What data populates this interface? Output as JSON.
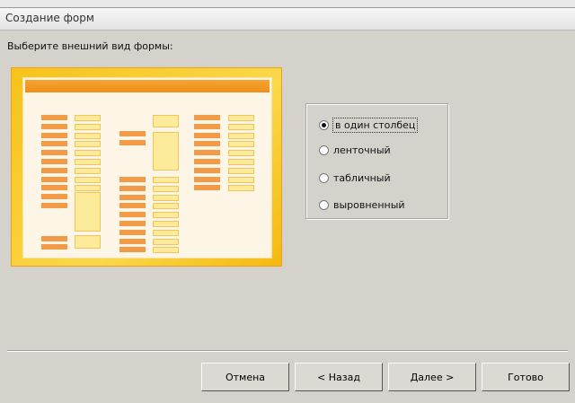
{
  "window": {
    "title": "Создание форм"
  },
  "prompt": "Выберите внешний вид формы:",
  "layout_options": [
    {
      "label": "в один столбец",
      "selected": true
    },
    {
      "label": "ленточный",
      "selected": false
    },
    {
      "label": "табличный",
      "selected": false
    },
    {
      "label": "выровненный",
      "selected": false
    }
  ],
  "buttons": {
    "cancel": "Отмена",
    "back": "< Назад",
    "next": "Далее >",
    "finish": "Готово"
  },
  "colors": {
    "preview_frame": "#f7c21a",
    "label_bar": "#f19a48",
    "field_bar": "#fbeb9a",
    "header_bar": "#f08d1a"
  }
}
